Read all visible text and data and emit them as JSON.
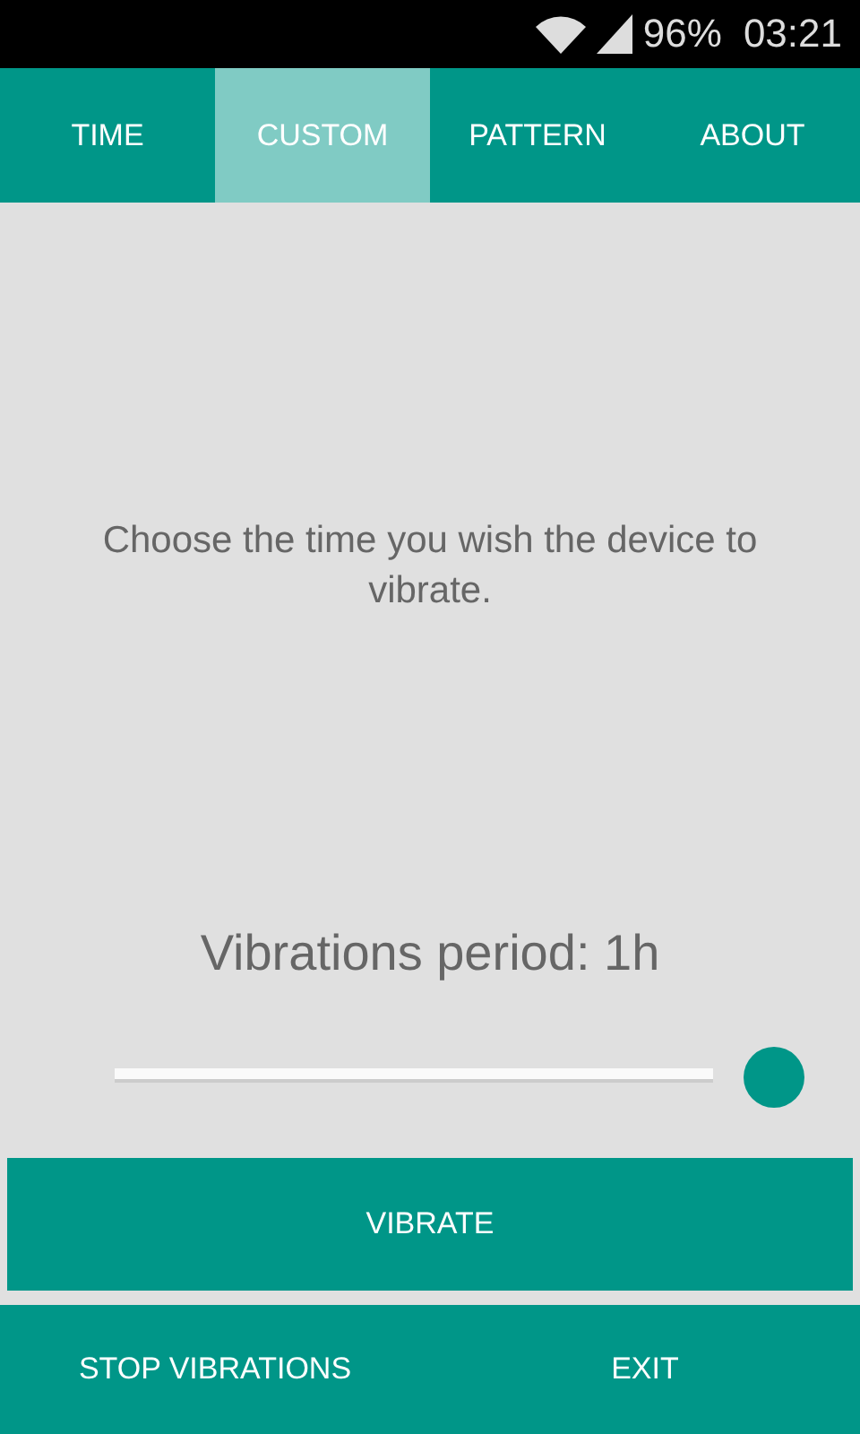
{
  "status_bar": {
    "battery": "96%",
    "time": "03:21"
  },
  "tabs": [
    {
      "label": "TIME",
      "selected": false
    },
    {
      "label": "CUSTOM",
      "selected": true
    },
    {
      "label": "PATTERN",
      "selected": false
    },
    {
      "label": "ABOUT",
      "selected": false
    }
  ],
  "message": "Choose the time you wish the device to vibrate.",
  "period_label": "Vibrations period: 1h",
  "slider": {
    "level": 1
  },
  "vibrate_button": "VIBRATE",
  "bottom_buttons": [
    "STOP VIBRATIONS",
    "EXIT"
  ]
}
